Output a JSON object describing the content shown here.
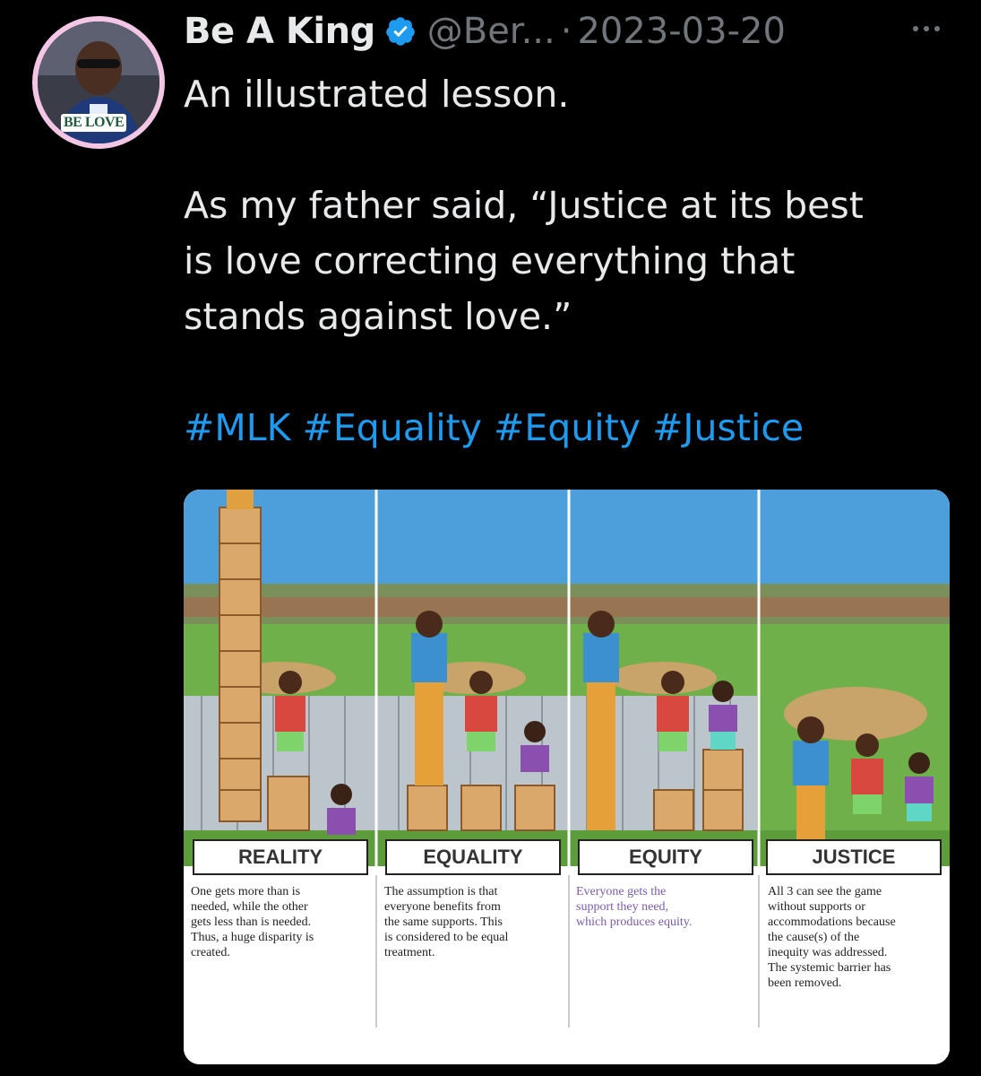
{
  "tweet": {
    "author": {
      "display_name": "Be A King",
      "handle": "@Ber...",
      "verified": true,
      "avatar_label": "BE LOVE"
    },
    "separator": "·",
    "date": "2023-03-20",
    "text_lines": [
      "An illustrated lesson.",
      "",
      "As my father said, “Justice at its best",
      "is love correcting everything that",
      "stands against love.”",
      "",
      "#MLK #Equality #Equity #Justice"
    ],
    "hashtag_color": "#1d9bf0"
  },
  "media": {
    "panels": [
      {
        "title": "REALITY",
        "caption": "One gets more than is\nneeded, while the other\ngets less than is needed.\nThus, a huge disparity is\ncreated."
      },
      {
        "title": "EQUALITY",
        "caption": "The assumption is that\neveryone benefits from\nthe same supports. This\nis considered to be equal\ntreatment."
      },
      {
        "title": "EQUITY",
        "caption": "Everyone gets the\nsupport they need,\nwhich produces equity."
      },
      {
        "title": "JUSTICE",
        "caption": "All 3 can see the game\nwithout supports or\naccommodations because\nthe cause(s) of the\ninequity was addressed.\nThe systemic barrier has\nbeen removed."
      }
    ]
  },
  "colors": {
    "background": "#000000",
    "text": "#e7e9ea",
    "muted": "#71767b",
    "link": "#1d9bf0",
    "avatar_ring": "#f2c6e4"
  },
  "icons": [
    "verified-badge-icon",
    "more-options-icon"
  ]
}
